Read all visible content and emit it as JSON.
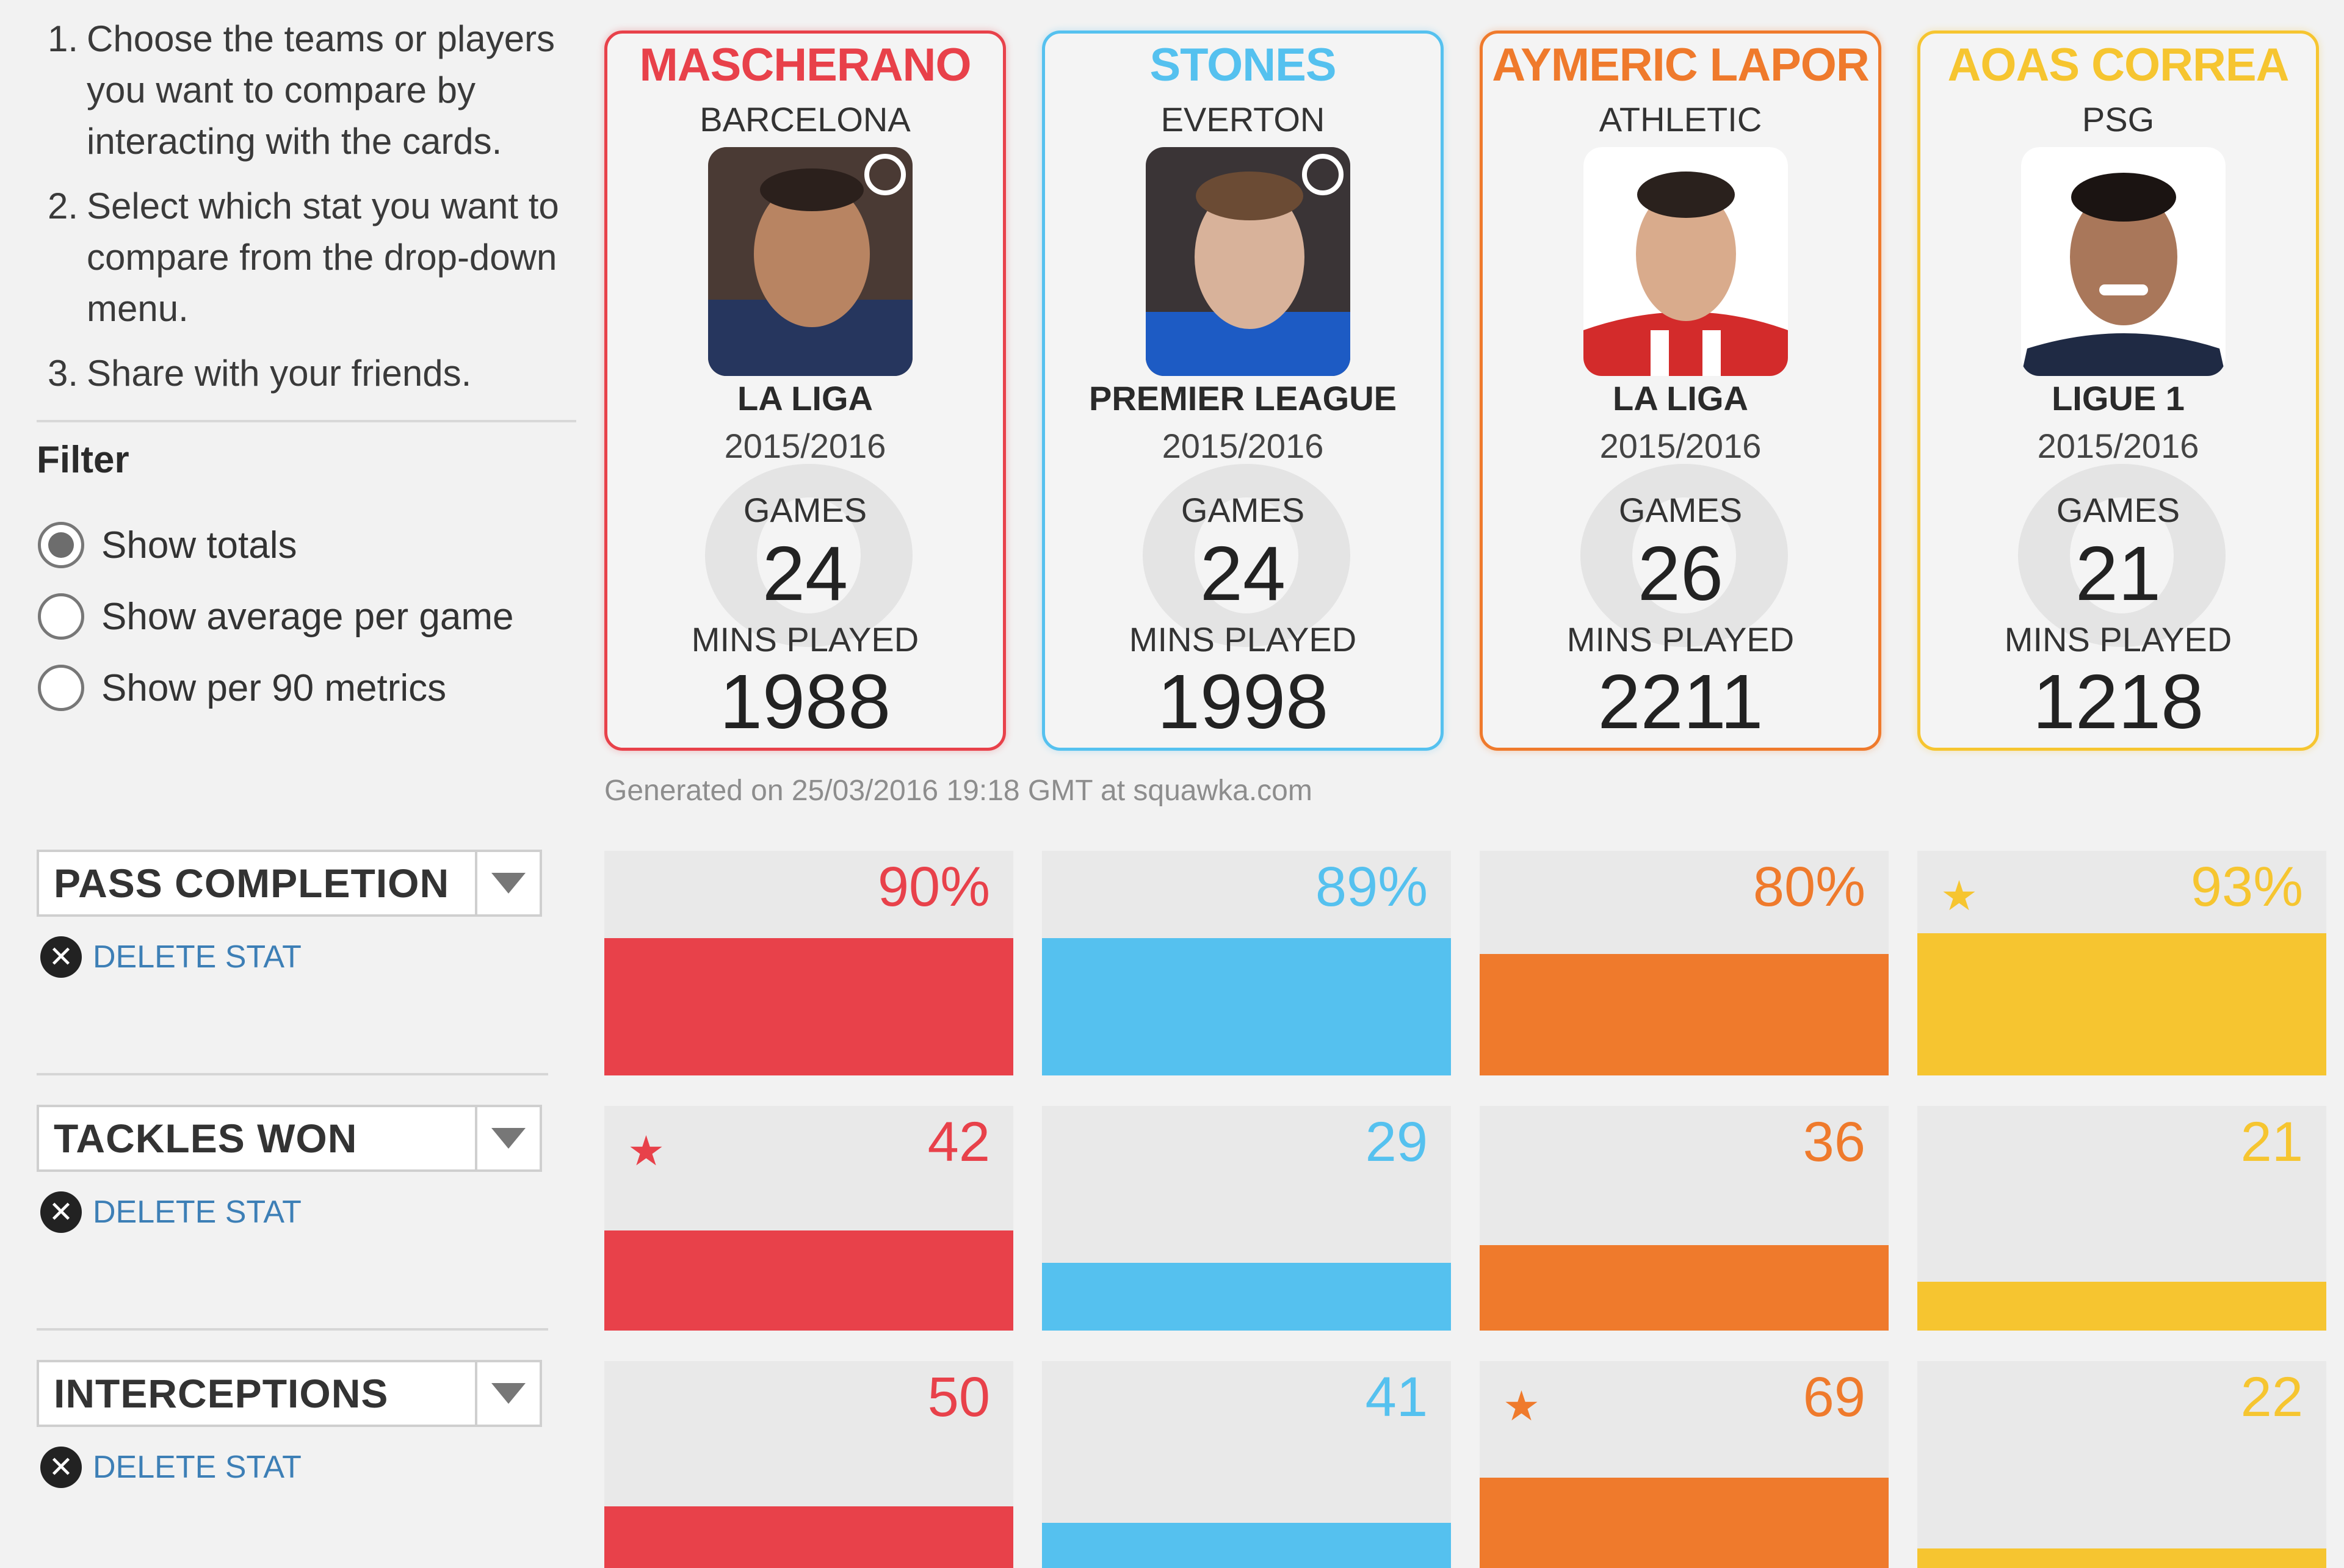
{
  "instructions": [
    {
      "num": "1.",
      "text": "Choose the teams or players you want to compare by interacting with the cards."
    },
    {
      "num": "2.",
      "text": "Select which stat you want to compare from the drop-down menu."
    },
    {
      "num": "3.",
      "text": "Share with your friends."
    }
  ],
  "filter": {
    "title": "Filter",
    "options": [
      {
        "label": "Show totals",
        "selected": true
      },
      {
        "label": "Show average per game",
        "selected": false
      },
      {
        "label": "Show per 90 metrics",
        "selected": false
      }
    ]
  },
  "players": [
    {
      "name": "MASCHERANO",
      "team": "BARCELONA",
      "league": "LA LIGA",
      "season": "2015/2016",
      "games_label": "GAMES",
      "games": "24",
      "mins_label": "MINS PLAYED",
      "mins": "1988",
      "color": "#e8414a"
    },
    {
      "name": "STONES",
      "team": "EVERTON",
      "league": "PREMIER LEAGUE",
      "season": "2015/2016",
      "games_label": "GAMES",
      "games": "24",
      "mins_label": "MINS PLAYED",
      "mins": "1998",
      "color": "#55c1ef"
    },
    {
      "name": "AYMERIC LAPOR",
      "team": "ATHLETIC",
      "league": "LA LIGA",
      "season": "2015/2016",
      "games_label": "GAMES",
      "games": "26",
      "mins_label": "MINS PLAYED",
      "mins": "2211",
      "color": "#ef7a2c"
    },
    {
      "name": "AOAS CORREA",
      "team": "PSG",
      "league": "LIGUE 1",
      "season": "2015/2016",
      "games_label": "GAMES",
      "games": "21",
      "mins_label": "MINS PLAYED",
      "mins": "1218",
      "color": "#f6c530"
    }
  ],
  "generated": "Generated on 25/03/2016 19:18 GMT at squawka.com",
  "stats": [
    {
      "label": "PASS COMPLETION",
      "delete_label": "DELETE STAT",
      "values": [
        "90%",
        "89%",
        "80%",
        "93%"
      ],
      "fill": [
        0.85,
        0.85,
        0.75,
        0.88
      ],
      "best": 3
    },
    {
      "label": "TACKLES WON",
      "delete_label": "DELETE STAT",
      "values": [
        "42",
        "29",
        "36",
        "21"
      ],
      "fill": [
        0.62,
        0.42,
        0.53,
        0.3
      ],
      "best": 0
    },
    {
      "label": "INTERCEPTIONS",
      "delete_label": "DELETE STAT",
      "values": [
        "50",
        "41",
        "69",
        "22"
      ],
      "fill": [
        0.38,
        0.28,
        0.56,
        0.12
      ],
      "best": 2
    }
  ],
  "icons": {
    "dropdown": "chevron-down-icon",
    "delete": "close-circle-icon",
    "best": "star-icon",
    "logo": "squawka-logo-icon"
  }
}
